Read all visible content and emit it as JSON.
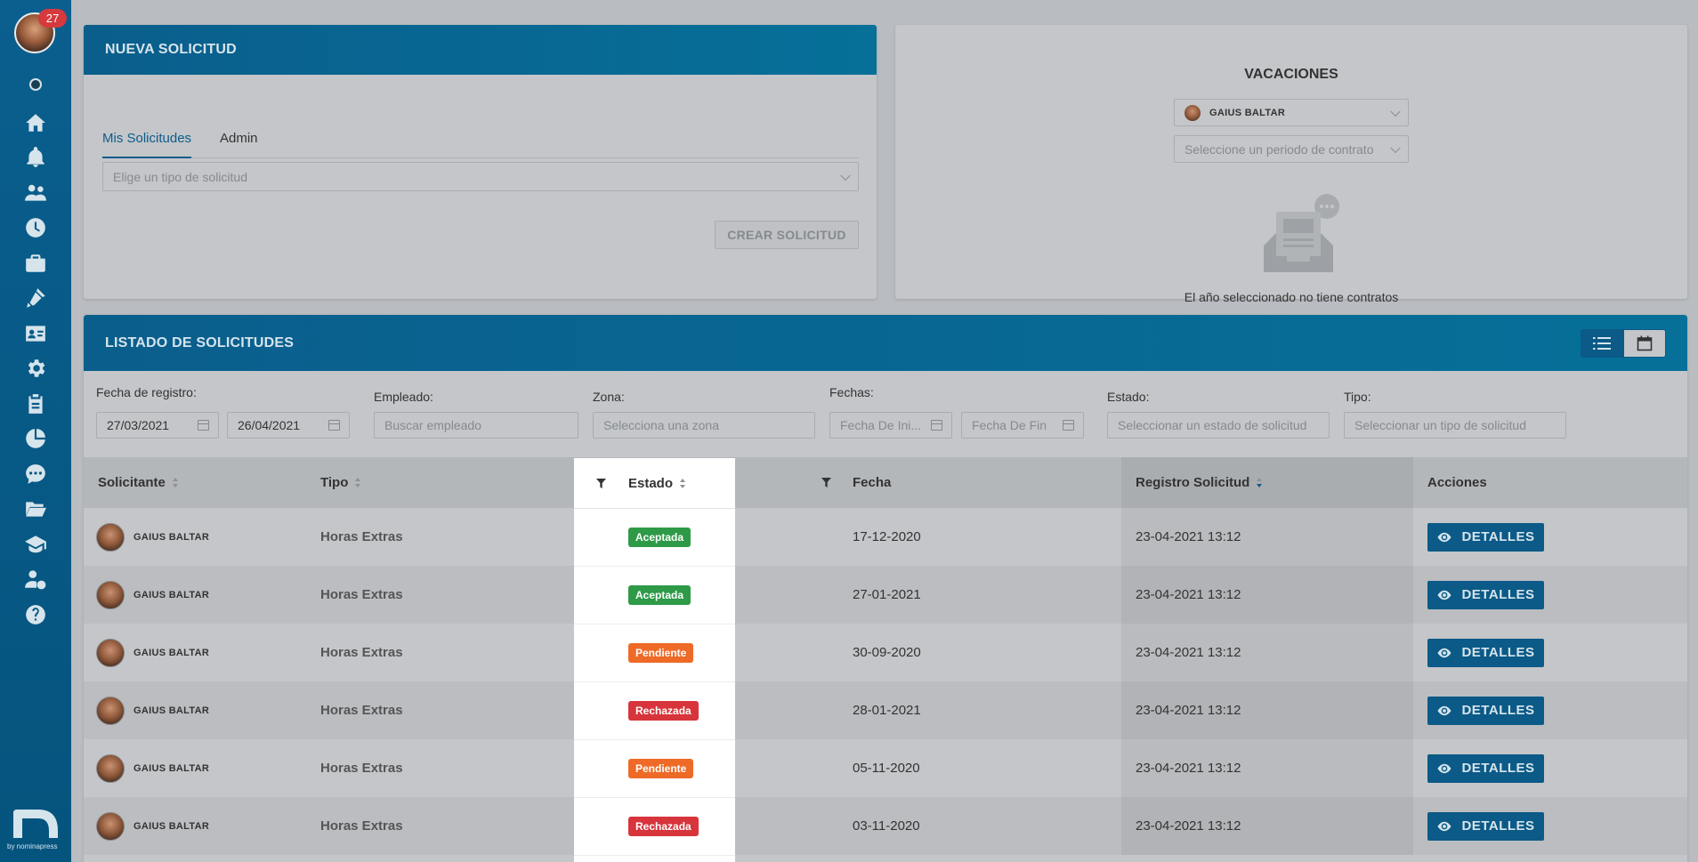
{
  "sidebar": {
    "badge_count": "27",
    "logo_text": "by nominapress",
    "items": [
      "home-icon",
      "bell-icon",
      "users-icon",
      "clock-icon",
      "briefcase-icon",
      "tools-icon",
      "id-card-icon",
      "gear-icon",
      "clipboard-icon",
      "pie-chart-icon",
      "chat-icon",
      "folder-icon",
      "graduation-cap-icon",
      "user-salary-icon",
      "help-icon"
    ]
  },
  "nueva": {
    "title": "NUEVA SOLICITUD",
    "tabs": [
      "Mis Solicitudes",
      "Admin"
    ],
    "select_placeholder": "Elige un tipo de solicitud",
    "create_label": "CREAR SOLICITUD"
  },
  "vacaciones": {
    "title": "VACACIONES",
    "employee": "GAIUS BALTAR",
    "period_placeholder": "Seleccione un periodo de contrato",
    "empty_text": "El año seleccionado no tiene contratos"
  },
  "listado": {
    "title": "LISTADO DE SOLICITUDES",
    "filters": {
      "fecha_registro_label": "Fecha de registro:",
      "fecha_desde": "27/03/2021",
      "fecha_hasta": "26/04/2021",
      "empleado_label": "Empleado:",
      "empleado_placeholder": "Buscar empleado",
      "zona_label": "Zona:",
      "zona_placeholder": "Selecciona una zona",
      "fechas_label": "Fechas:",
      "fecha_inicio_placeholder": "Fecha De Ini...",
      "fecha_fin_placeholder": "Fecha De Fin",
      "estado_label": "Estado:",
      "estado_placeholder": "Seleccionar un estado de solicitud",
      "tipo_label": "Tipo:",
      "tipo_placeholder": "Seleccionar un tipo de solicitud"
    },
    "columns": {
      "solicitante": "Solicitante",
      "tipo": "Tipo",
      "estado": "Estado",
      "fecha": "Fecha",
      "registro": "Registro Solicitud",
      "acciones": "Acciones"
    },
    "details_label": "DETALLES",
    "status_colors": {
      "Aceptada": "#2e9a48",
      "Pendiente": "#ee6a26",
      "Rechazada": "#d7353b"
    },
    "rows": [
      {
        "name": "GAIUS BALTAR",
        "type": "Horas Extras",
        "status": "Aceptada",
        "fecha": "17-12-2020",
        "registro": "23-04-2021 13:12"
      },
      {
        "name": "GAIUS BALTAR",
        "type": "Horas Extras",
        "status": "Aceptada",
        "fecha": "27-01-2021",
        "registro": "23-04-2021 13:12"
      },
      {
        "name": "GAIUS BALTAR",
        "type": "Horas Extras",
        "status": "Pendiente",
        "fecha": "30-09-2020",
        "registro": "23-04-2021 13:12"
      },
      {
        "name": "GAIUS BALTAR",
        "type": "Horas Extras",
        "status": "Rechazada",
        "fecha": "28-01-2021",
        "registro": "23-04-2021 13:12"
      },
      {
        "name": "GAIUS BALTAR",
        "type": "Horas Extras",
        "status": "Pendiente",
        "fecha": "05-11-2020",
        "registro": "23-04-2021 13:12"
      },
      {
        "name": "GAIUS BALTAR",
        "type": "Horas Extras",
        "status": "Rechazada",
        "fecha": "03-11-2020",
        "registro": "23-04-2021 13:12"
      }
    ]
  }
}
